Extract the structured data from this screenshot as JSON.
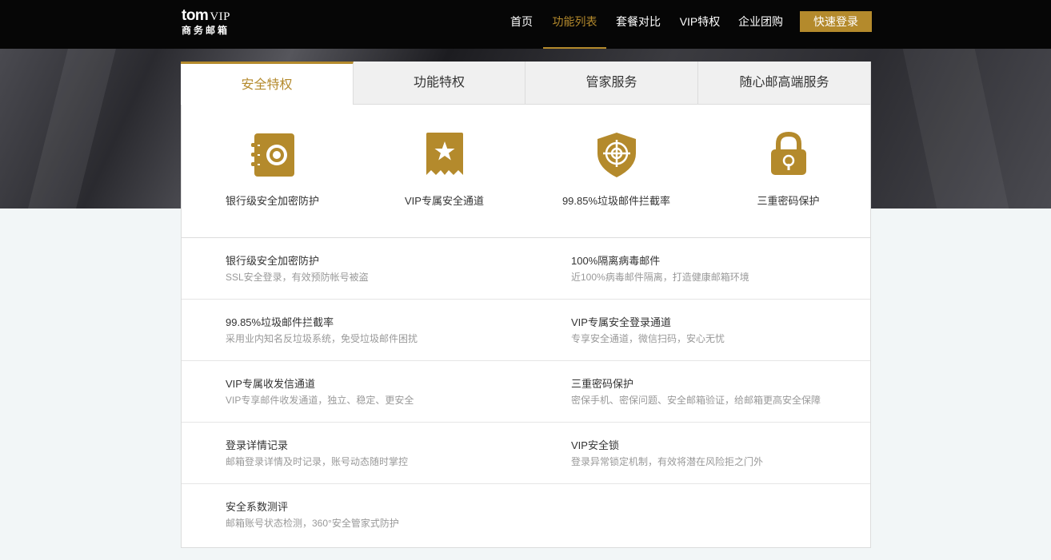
{
  "logo": {
    "brand": "tom",
    "vip": "VIP",
    "sub": "商务邮箱"
  },
  "nav": {
    "items": [
      {
        "label": "首页",
        "active": false
      },
      {
        "label": "功能列表",
        "active": true
      },
      {
        "label": "套餐对比",
        "active": false
      },
      {
        "label": "VIP特权",
        "active": false
      },
      {
        "label": "企业团购",
        "active": false
      }
    ],
    "login_label": "快速登录"
  },
  "tabs": [
    {
      "label": "安全特权",
      "active": true
    },
    {
      "label": "功能特权",
      "active": false
    },
    {
      "label": "管家服务",
      "active": false
    },
    {
      "label": "随心邮高端服务",
      "active": false
    }
  ],
  "features": [
    {
      "icon": "safe-icon",
      "label": "银行级安全加密防护"
    },
    {
      "icon": "star-ticket-icon",
      "label": "VIP专属安全通道"
    },
    {
      "icon": "shield-target-icon",
      "label": "99.85%垃圾邮件拦截率"
    },
    {
      "icon": "padlock-icon",
      "label": "三重密码保护"
    }
  ],
  "details": [
    [
      {
        "title": "银行级安全加密防护",
        "desc": "SSL安全登录，有效预防帐号被盗"
      },
      {
        "title": "100%隔离病毒邮件",
        "desc": "近100%病毒邮件隔离，打造健康邮箱环境"
      }
    ],
    [
      {
        "title": "99.85%垃圾邮件拦截率",
        "desc": "采用业内知名反垃圾系统，免受垃圾邮件困扰"
      },
      {
        "title": "VIP专属安全登录通道",
        "desc": "专享安全通道，微信扫码，安心无忧"
      }
    ],
    [
      {
        "title": "VIP专属收发信通道",
        "desc": "VIP专享邮件收发通道，独立、稳定、更安全"
      },
      {
        "title": "三重密码保护",
        "desc": "密保手机、密保问题、安全邮箱验证，给邮箱更高安全保障"
      }
    ],
    [
      {
        "title": "登录详情记录",
        "desc": "邮箱登录详情及时记录，账号动态随时掌控"
      },
      {
        "title": "VIP安全锁",
        "desc": "登录异常锁定机制，有效将潜在风险拒之门外"
      }
    ],
    [
      {
        "title": "安全系数测评",
        "desc": "邮箱账号状态检测，360°安全管家式防护"
      }
    ]
  ],
  "colors": {
    "accent": "#b48a2c",
    "topbar": "#060606",
    "background": "#f2f6f7"
  }
}
